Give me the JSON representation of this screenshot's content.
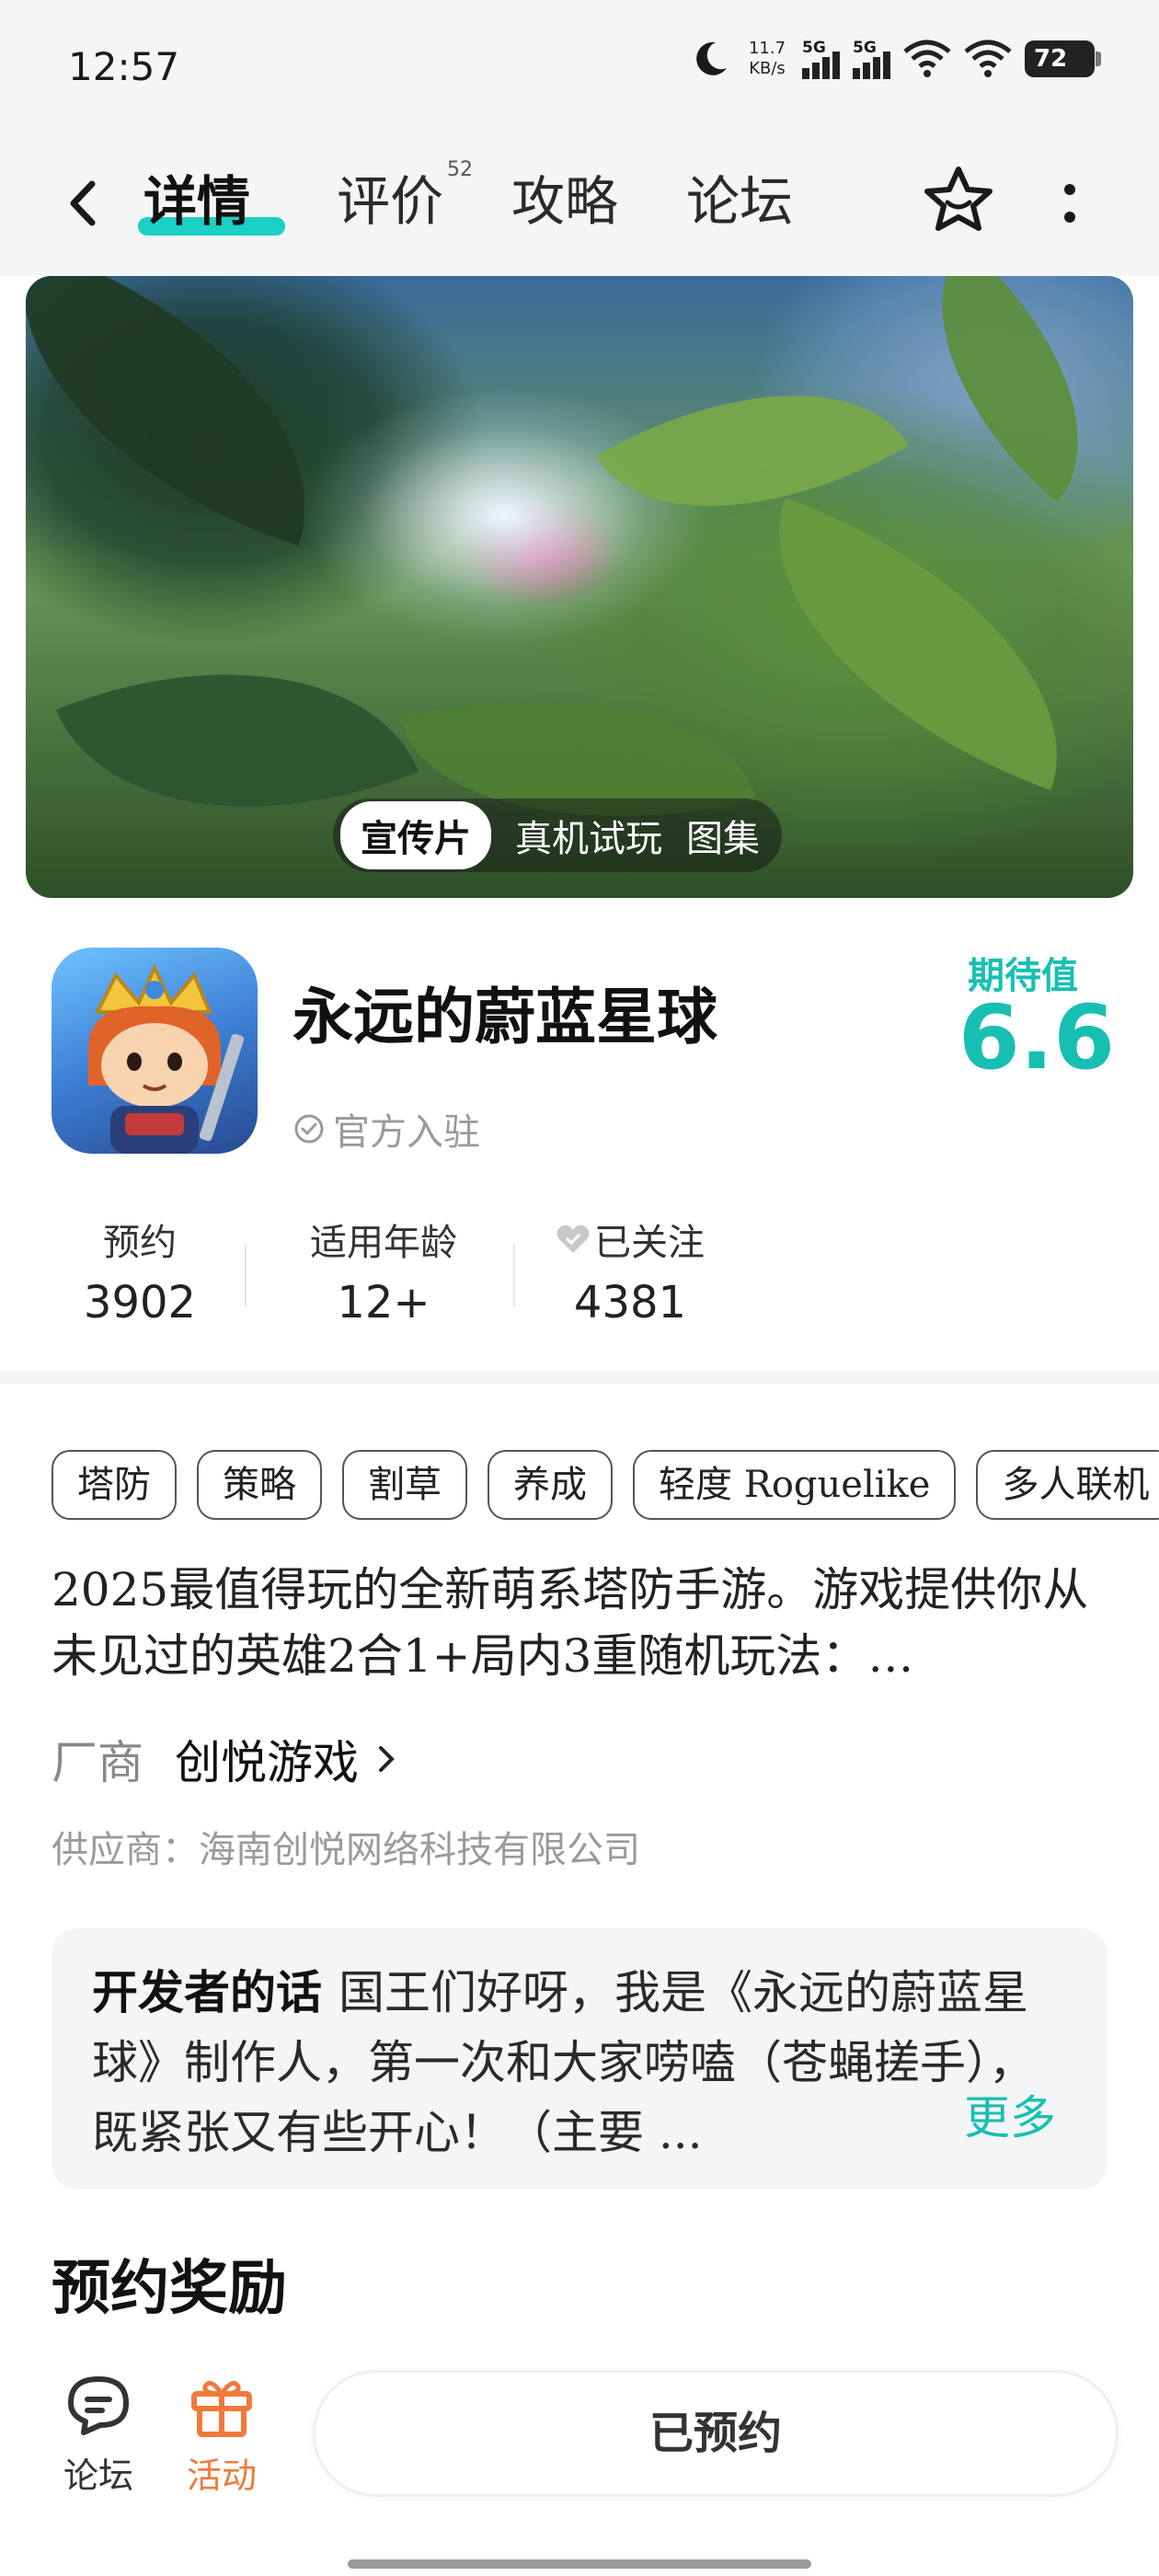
{
  "status_bar": {
    "time": "12:57",
    "net_speed_value": "11.7",
    "net_speed_unit": "KB/s",
    "sim1_label": "5G",
    "sim2_label": "5G",
    "battery": "72"
  },
  "nav": {
    "tabs": [
      {
        "label": "详情",
        "active": true
      },
      {
        "label": "评价",
        "badge": "52"
      },
      {
        "label": "攻略"
      },
      {
        "label": "论坛"
      }
    ],
    "icons": [
      "back-chevron-icon",
      "star-outline-icon",
      "more-vertical-icon"
    ]
  },
  "banner": {
    "tabs": [
      {
        "label": "宣传片",
        "active": true
      },
      {
        "label": "真机试玩"
      },
      {
        "label": "图集"
      }
    ]
  },
  "game": {
    "title": "永远的蔚蓝星球",
    "official_label": "官方入驻",
    "expect_label": "期待值",
    "expect_value": "6.6"
  },
  "stats": [
    {
      "label": "预约",
      "value": "3902"
    },
    {
      "label": "适用年龄",
      "value": "12+"
    },
    {
      "label": "已关注",
      "value": "4381"
    }
  ],
  "tags": [
    "塔防",
    "策略",
    "割草",
    "养成",
    "轻度 Roguelike",
    "多人联机"
  ],
  "description": "2025最值得玩的全新萌系塔防手游。游戏提供你从未见过的英雄2合1+局内3重随机玩法：…",
  "vendor": {
    "label": "厂商",
    "name": "创悦游戏"
  },
  "supplier": "供应商：海南创悦网络科技有限公司",
  "developer_note": {
    "label": "开发者的话",
    "text": "国王们好呀，我是《永远的蔚蓝星球》制作人，第一次和大家唠嗑（苍蝇搓手），既紧张又有些开心！（主要 ...",
    "more": "更多"
  },
  "reward_section_title": "预约奖励",
  "bottom_bar": {
    "forum_label": "论坛",
    "activity_label": "活动",
    "reserve_button": "已预约",
    "colors": {
      "activity": "#f07a3a",
      "accent": "#17bfb3"
    }
  }
}
